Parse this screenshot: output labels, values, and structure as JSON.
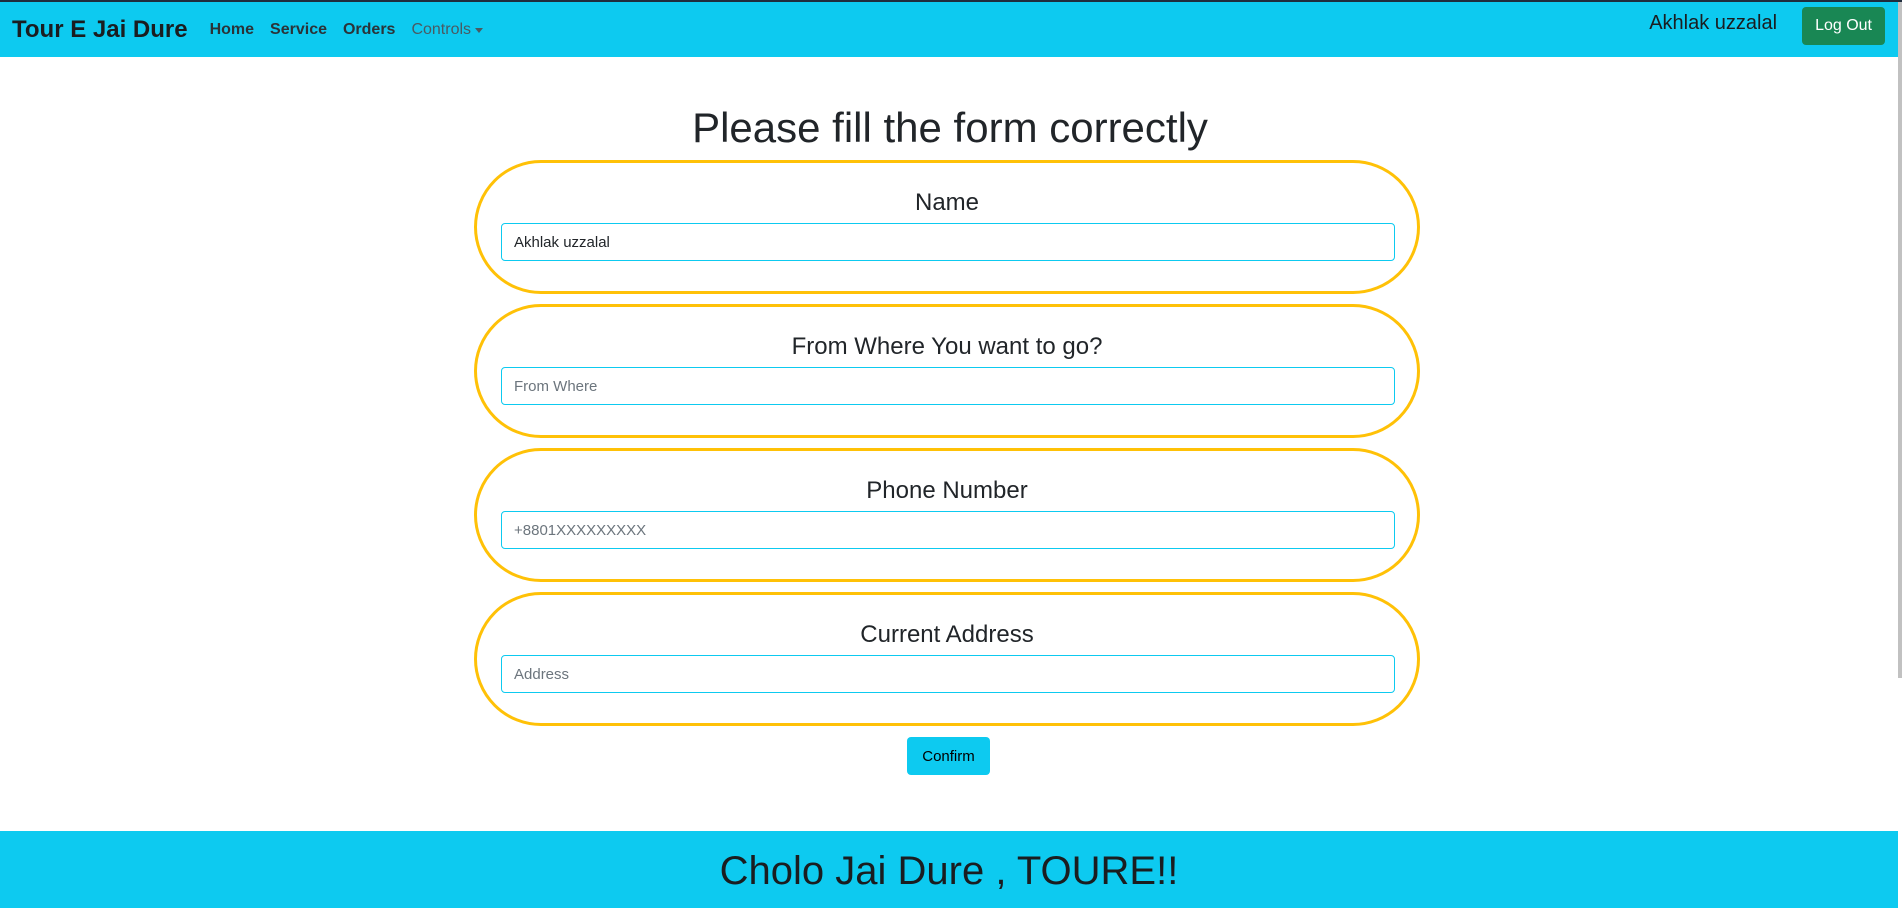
{
  "navbar": {
    "brand": "Tour E Jai Dure",
    "links": [
      "Home",
      "Service",
      "Orders"
    ],
    "dropdown_label": "Controls",
    "user_name": "Akhlak uzzalal",
    "logout_label": "Log Out"
  },
  "form": {
    "title": "Please fill the form correctly",
    "fields": [
      {
        "label": "Name",
        "value": "Akhlak uzzalal",
        "placeholder": ""
      },
      {
        "label": "From Where You want to go?",
        "value": "",
        "placeholder": "From Where"
      },
      {
        "label": "Phone Number",
        "value": "",
        "placeholder": "+8801XXXXXXXXX"
      },
      {
        "label": "Current Address",
        "value": "",
        "placeholder": "Address"
      }
    ],
    "confirm_label": "Confirm"
  },
  "footer": {
    "text": "Cholo Jai Dure , TOURE!!"
  },
  "colors": {
    "navbar_bg": "#0dcaf0",
    "field_border": "#ffc107",
    "logout_bg": "#198754",
    "confirm_bg": "#0dcaf0"
  }
}
